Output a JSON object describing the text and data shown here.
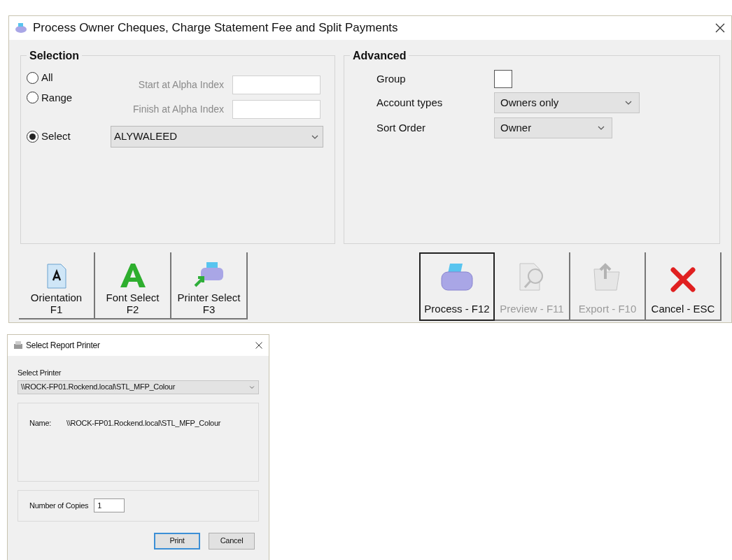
{
  "main_window": {
    "title": "Process Owner Cheques, Charge Statement Fee and Split Payments",
    "selection": {
      "title": "Selection",
      "options": [
        {
          "label": "All",
          "selected": false
        },
        {
          "label": "Range",
          "selected": false
        },
        {
          "label": "Select",
          "selected": true
        }
      ],
      "range_fields": [
        {
          "label": "Start at Alpha Index",
          "disabled": true
        },
        {
          "label": "Finish at Alpha Index",
          "disabled": true
        }
      ],
      "select_value": "ALYWALEED"
    },
    "advanced": {
      "title": "Advanced",
      "group": {
        "label": "Group",
        "checked": false
      },
      "account_types": {
        "label": "Account types",
        "value": "Owners only"
      },
      "sort_order": {
        "label": "Sort Order",
        "value": "Owner"
      }
    },
    "left_buttons": [
      {
        "kind": "orientation",
        "label": "Orientation",
        "key": "F1"
      },
      {
        "kind": "font",
        "label": "Font Select",
        "key": "F2"
      },
      {
        "kind": "printer-select",
        "label": "Printer Select",
        "key": "F3"
      }
    ],
    "right_buttons": [
      {
        "kind": "process",
        "label": "Process - F12",
        "default": true,
        "disabled": false
      },
      {
        "kind": "preview",
        "label": "Preview - F11",
        "default": false,
        "disabled": true
      },
      {
        "kind": "export",
        "label": "Export - F10",
        "default": false,
        "disabled": true
      },
      {
        "kind": "cancel",
        "label": "Cancel - ESC",
        "default": false,
        "disabled": false
      }
    ]
  },
  "printer_dialog": {
    "title": "Select Report Printer",
    "select_label": "Select Printer",
    "printer": "\\\\ROCK-FP01.Rockend.local\\STL_MFP_Colour",
    "name_label": "Name:",
    "name_value": "\\\\ROCK-FP01.Rockend.local\\STL_MFP_Colour",
    "copies_label": "Number of Copies",
    "copies": "1",
    "buttons": [
      {
        "label": "Print",
        "default": true
      },
      {
        "label": "Cancel",
        "default": false
      }
    ]
  }
}
